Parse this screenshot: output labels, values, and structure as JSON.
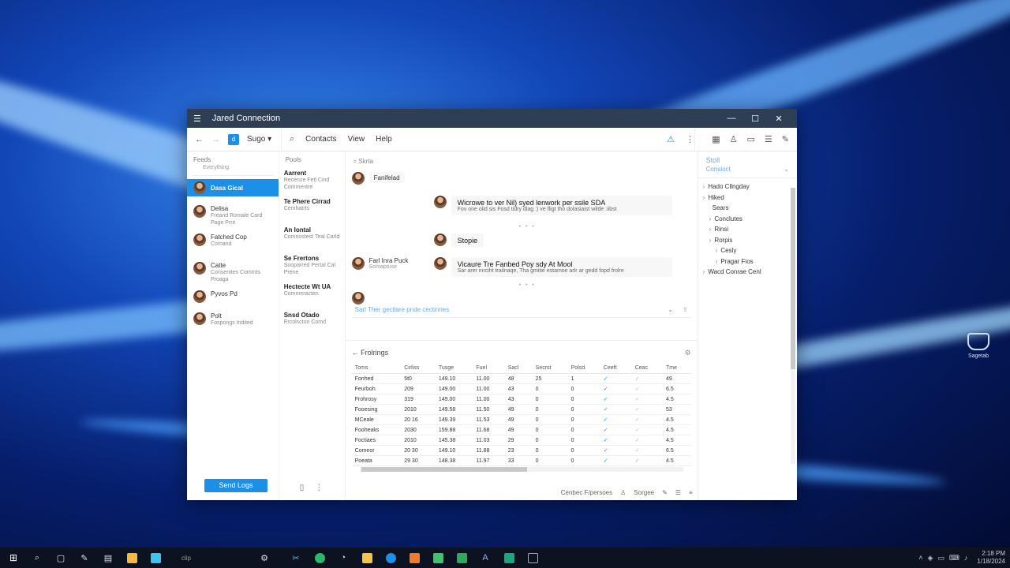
{
  "window": {
    "title": "Jared Connection"
  },
  "toolbar": {
    "app_label": "Sugo",
    "menu": [
      "Contacts",
      "View",
      "Help"
    ]
  },
  "sidebar": {
    "section": "Feeds",
    "section_sub": "Everything",
    "contacts": [
      {
        "name": "Dasa Gical",
        "sub": "",
        "active": true
      },
      {
        "name": "Delisa",
        "sub": "Freand Romale Card\nPage Prnt"
      },
      {
        "name": "Fatched Cop",
        "sub": "Comand"
      },
      {
        "name": "Catte",
        "sub": "Consenites Commts\nProaga"
      },
      {
        "name": "Pyvos Pd",
        "sub": ""
      },
      {
        "name": "Polt",
        "sub": "Fospongs Indited"
      }
    ],
    "send_button": "Send Logs"
  },
  "column2": {
    "header": "Pools",
    "items": [
      {
        "name": "Aarrent",
        "sub": "Recenze Fetl Cind\nCommentre"
      },
      {
        "name": "Te Phere Cirrad",
        "sub": "Cemhatrts"
      },
      {
        "name": "An Iontal",
        "sub": "Comnostest Teal Carld"
      },
      {
        "name": "Se Frertons",
        "sub": "Sooparred Pertal Cal\nPrene"
      },
      {
        "name": "Hectecte Wt UA",
        "sub": "Commeracten"
      },
      {
        "name": "Snsd Otado",
        "sub": "Ercolscton Comd"
      }
    ]
  },
  "chat": {
    "search": "Skrta",
    "first_sender": "Fanifelad",
    "messages": [
      {
        "title": "Wicrowe to ver Nil) syed lenwork per ssile SDA",
        "sub": "Fov one olid sis Fosd tidry dlag :) ve fligt tho dolasiaist wilde :iibst"
      },
      {
        "title": "Stopie",
        "sub": ""
      },
      {
        "title": "Vicaure Tre Fanbed Poy sdy At Mool",
        "sub": "Sar arer inrciht trailnaqe, Tha gmitie estamoe arlr ar gedd fopd frolre"
      }
    ],
    "side_sender": {
      "name": "Farl Inra Puck",
      "sub": "Somaptuse"
    },
    "compose_placeholder": "Sarl Ther gectiare pnde cectinnes"
  },
  "table": {
    "title": "Frolrings",
    "columns": [
      "Toms",
      "Cirliss",
      "Tusge",
      "Fuel",
      "Sacl",
      "Secrst",
      "Polsd",
      "Ceeft",
      "Ceac",
      "Tme"
    ],
    "rows": [
      [
        "Fonhed",
        "5t0",
        "149.10",
        "11.00",
        "48",
        "25",
        "1",
        "check",
        "off",
        "49"
      ],
      [
        "Feurboh",
        "209",
        "149.00",
        "11.00",
        "43",
        "0",
        "0",
        "check",
        "off",
        "6.5"
      ],
      [
        "Frohrosy",
        "319",
        "149.00",
        "11.00",
        "43",
        "0",
        "0",
        "check",
        "off",
        "4.5"
      ],
      [
        "Fooesing",
        "2010",
        "149.58",
        "11.50",
        "49",
        "0",
        "0",
        "check",
        "off",
        "53"
      ],
      [
        "MCeale",
        "20 16",
        "149.39",
        "11.53",
        "49",
        "0",
        "0",
        "check",
        "off",
        "4.5"
      ],
      [
        "Fooheaks",
        "2030",
        "159.88",
        "11.68",
        "49",
        "0",
        "0",
        "check",
        "off",
        "4.5"
      ],
      [
        "Foctiaes",
        "2010",
        "145.38",
        "11.03",
        "29",
        "0",
        "0",
        "check",
        "off",
        "4.5"
      ],
      [
        "Comeor",
        "20 30",
        "149.10",
        "11.88",
        "23",
        "0",
        "0",
        "check",
        "off",
        "6.5"
      ],
      [
        "Poeata",
        "29 30",
        "148.38",
        "11.97",
        "33",
        "0",
        "0",
        "check",
        "off",
        "4.5"
      ]
    ]
  },
  "status": {
    "left": "Cenbec F/persoes",
    "right": "Sorgee"
  },
  "right_panel": {
    "title": "Stoll",
    "subtitle": "Consloct",
    "tree": [
      {
        "label": "Hado Cllngday",
        "indent": 0,
        "arrow": "›"
      },
      {
        "label": "Hiked",
        "indent": 0,
        "arrow": "›"
      },
      {
        "label": "Sears",
        "indent": 1,
        "arrow": ""
      },
      {
        "label": "Conclutes",
        "indent": 1,
        "arrow": "›"
      },
      {
        "label": "Rinsi",
        "indent": 1,
        "arrow": "›"
      },
      {
        "label": "Rorpis",
        "indent": 1,
        "arrow": "›"
      },
      {
        "label": "Cesly",
        "indent": 2,
        "arrow": "›"
      },
      {
        "label": "Pragar Fios",
        "indent": 2,
        "arrow": "›"
      },
      {
        "label": "Wacd Conrae Cenl",
        "indent": 0,
        "arrow": "›"
      }
    ]
  },
  "desktop_icon": {
    "label": "Sagetab"
  },
  "taskbar": {
    "search": "clip",
    "time": "2:18 PM",
    "date": "1/18/2024"
  },
  "colors": {
    "accent": "#1e8fe6",
    "titlebar": "#2d3e55",
    "taskbar": "#0d1220"
  }
}
